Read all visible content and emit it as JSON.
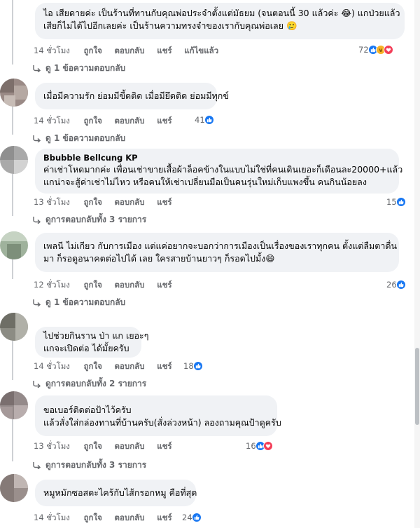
{
  "comments": [
    {
      "author": "",
      "lines": [
        "ไอ เสียดายค่ะ เป็นร้านที่ทานกับคุณพ่อประจำตั้งแต่มัธยม (จนตอนนี้ 30 แล้วค่ะ 😂) แกป่วยแล้ว",
        "เสียก็ไม่ได้ไปอีกเลยค่ะ เป็นร้านความทรงจำของเรากับคุณพ่อเลย 🥲"
      ],
      "time": "14 ชั่วโมง",
      "like": "ถูกใจ",
      "reply": "ตอบกลับ",
      "share": "แชร์",
      "edited": "แก้ไขแล้ว",
      "reaction_count": "72",
      "reactions": [
        "like",
        "haha",
        "love"
      ],
      "replies_text": "ดู 1 ข้อความตอบกลับ"
    },
    {
      "author": "",
      "lines": [
        "เมื่อมีความรัก ย่อมมีขี้ดติด เมื่อมียึดติด ย่อมมีทุกข์"
      ],
      "time": "14 ชั่วโมง",
      "like": "ถูกใจ",
      "reply": "ตอบกลับ",
      "share": "แชร์",
      "reaction_count": "41",
      "reactions": [
        "like"
      ],
      "replies_text": "ดู 1 ข้อความตอบกลับ"
    },
    {
      "author": "Bbubble Bellcung KP",
      "lines": [
        "ค่าเช่าโหดมากค่ะ เพื่อนเช่าขายเสื้อผ้าล็อคข้างในแบบไม่ใช่ที่คนเดินเยอะก็เดือนละ20000+แล้ว",
        "แกน่าจะสู้ค่าเช่าไม่ไหว หรือคนให้เช่าเปลี่ยนมือเป็นคนรุ่นใหม่เก็บแพงขึ้น คนกินน้อยลง"
      ],
      "time": "13 ชั่วโมง",
      "like": "ถูกใจ",
      "reply": "ตอบกลับ",
      "share": "แชร์",
      "reaction_count": "15",
      "reactions": [
        "like"
      ],
      "replies_text": "ดูการตอบกลับทั้ง 3 รายการ"
    },
    {
      "author": "",
      "lines": [
        "เพลนี ไม่เกียว กับการเมือง แต่แค่อยากจะบอกว่าการเมืองเป็นเรื่องของเราทุกคน ตั้งแต่ลืมตาดื่น",
        "มา ก็รอดูอนาคตต่อไปได้ เลย ใครสายบ้านยาวๆ ก็รอดไปมั้ง😄"
      ],
      "time": "12 ชั่วโมง",
      "like": "ถูกใจ",
      "reply": "ตอบกลับ",
      "share": "แชร์",
      "reaction_count": "26",
      "reactions": [
        "like"
      ],
      "replies_text": "ดู 1 ข้อความตอบกลับ"
    },
    {
      "author": "",
      "lines": [
        "ไปช่วยกินราน ป่า แก เยอะๆ",
        "แกจะเปิดต่อ ได้มั้ยครับ"
      ],
      "time": "14 ชั่วโมง",
      "like": "ถูกใจ",
      "reply": "ตอบกลับ",
      "share": "แชร์",
      "reaction_count": "18",
      "reactions": [
        "like"
      ],
      "replies_text": "ดูการตอบกลับทั้ง 2 รายการ"
    },
    {
      "author": "",
      "lines": [
        "ขอเบอร์ติดต่อป้าไว้ครับ",
        "แล้วสั่งใส่กล่องทานที่บ้านครับ(สั่งล่วงหน้า) ลองถามคุณป้าดูครับ"
      ],
      "time": "13 ชั่วโมง",
      "like": "ถูกใจ",
      "reply": "ตอบกลับ",
      "share": "แชร์",
      "reaction_count": "16",
      "reactions": [
        "like",
        "love"
      ],
      "replies_text": "ดูการตอบกลับทั้ง 3 รายการ"
    },
    {
      "author": "",
      "lines": [
        "หมูหมักซอสตะไคร้กับไส้กรอกหมู คือที่สุด"
      ],
      "time": "14 ชั่วโมง",
      "like": "ถูกใจ",
      "reply": "ตอบกลับ",
      "share": "แชร์",
      "reaction_count": "24",
      "reactions": [
        "like"
      ],
      "replies_text": ""
    }
  ],
  "colors": {
    "bubble": "#f0f2f5",
    "meta": "#65676b",
    "like": "#1877f2",
    "love": "#f33e58",
    "haha": "#f7b125"
  }
}
